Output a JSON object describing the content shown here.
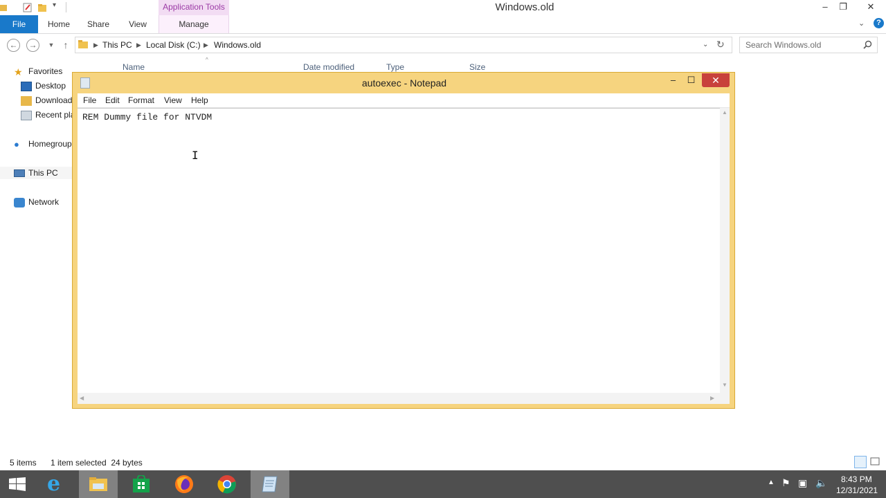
{
  "explorer": {
    "title": "Windows.old",
    "contextual_tab": "Application Tools",
    "ribbon_tabs": [
      "File",
      "Home",
      "Share",
      "View",
      "Manage"
    ],
    "breadcrumb": [
      "This PC",
      "Local Disk (C:)",
      "Windows.old"
    ],
    "search_placeholder": "Search Windows.old",
    "nav_pane": {
      "favorites": "Favorites",
      "favorite_items": [
        "Desktop",
        "Downloads",
        "Recent places"
      ],
      "homegroup": "Homegroup",
      "this_pc": "This PC",
      "network": "Network"
    },
    "columns": [
      "Name",
      "Date modified",
      "Type",
      "Size"
    ],
    "status": {
      "items": "5 items",
      "selected": "1 item selected  24 bytes"
    }
  },
  "notepad": {
    "title": "autoexec - Notepad",
    "menu": [
      "File",
      "Edit",
      "Format",
      "View",
      "Help"
    ],
    "content": "REM Dummy file for NTVDM"
  },
  "taskbar": {
    "time": "8:43 PM",
    "date": "12/31/2021",
    "apps": [
      "start-button",
      "internet-explorer",
      "file-explorer",
      "store",
      "firefox",
      "chrome",
      "notepad"
    ]
  },
  "colors": {
    "accent_file_tab": "#1979ca",
    "contextual_tab": "#f2dcf3",
    "notepad_frame": "#f6d47f",
    "close_button": "#c8413b",
    "taskbar": "#4f4f4f"
  }
}
